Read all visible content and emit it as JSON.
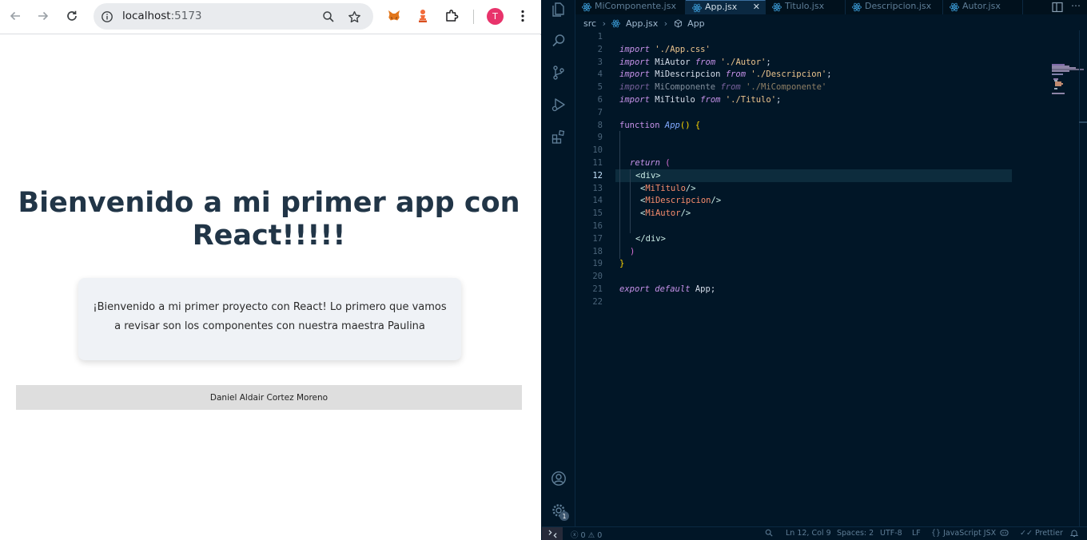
{
  "browser": {
    "url_host": "localhost",
    "url_port": ":5173",
    "avatar_initial": "T",
    "icons": [
      "back-arrow-icon",
      "forward-arrow-icon",
      "reload-icon",
      "site-info-icon",
      "zoom-icon",
      "star-icon",
      "metamask-icon",
      "chess-pawn-icon",
      "puzzle-icon",
      "kebab-menu-icon"
    ]
  },
  "app": {
    "title": "Bienvenido a mi primer app con React!!!!!",
    "description": "¡Bienvenido a mi primer proyecto con React! Lo primero que vamos a revisar son los componentes con nuestra maestra Paulina",
    "author": "Daniel Aldair Cortez Moreno"
  },
  "vscode": {
    "tabs": [
      {
        "label": "MiComponente.jsx"
      },
      {
        "label": "App.jsx",
        "active": true
      },
      {
        "label": "Titulo.jsx"
      },
      {
        "label": "Descripcion.jsx"
      },
      {
        "label": "Autor.jsx"
      }
    ],
    "tab_close_glyph": "✕",
    "breadcrumb": {
      "folder": "src",
      "file": "App.jsx",
      "symbol": "App"
    },
    "line_numbers": [
      "1",
      "2",
      "3",
      "4",
      "5",
      "6",
      "7",
      "8",
      "9",
      "10",
      "11",
      "12",
      "13",
      "14",
      "15",
      "16",
      "17",
      "18",
      "19",
      "20",
      "21",
      "22"
    ],
    "current_line": "12",
    "code": {
      "l2": {
        "kw": "import",
        "str": "'./App.css'"
      },
      "l3": {
        "kw": "import",
        "id": "MiAutor",
        "from": "from",
        "str": "'./Autor'",
        "end": ";"
      },
      "l4": {
        "kw": "import",
        "id": "MiDescripcion",
        "from": "from",
        "str": "'./Descripcion'",
        "end": ";"
      },
      "l5": {
        "kw": "import",
        "id": "MiComponente",
        "from": "from",
        "str": "'./MiComponente'"
      },
      "l6": {
        "kw": "import",
        "id": "MiTitulo",
        "from": "from",
        "str": "'./Titulo'",
        "end": ";"
      },
      "l8": {
        "kw": "function",
        "fn": "App",
        "paren": "()",
        "brace": "{"
      },
      "l11": {
        "kw": "return",
        "paren": "("
      },
      "l12": {
        "tag": "<div>"
      },
      "l13": {
        "open": "<",
        "comp": "MiTitulo",
        "close": "/>"
      },
      "l14": {
        "open": "<",
        "comp": "MiDescripcion",
        "close": "/>"
      },
      "l15": {
        "open": "<",
        "comp": "MiAutor",
        "close": "/>"
      },
      "l17": {
        "tag": "</div>"
      },
      "l18": {
        "paren": ")"
      },
      "l19": {
        "brace": "}"
      },
      "l21": {
        "kw": "export",
        "kw2": "default",
        "id": "App",
        "end": ";"
      }
    },
    "status": {
      "errors": "0",
      "warnings": "0",
      "position": "Ln 12, Col 9",
      "spaces": "Spaces: 2",
      "encoding": "UTF-8",
      "eol": "LF",
      "language": "JavaScript JSX",
      "prettier": "Prettier",
      "settings_badge": "1"
    }
  }
}
